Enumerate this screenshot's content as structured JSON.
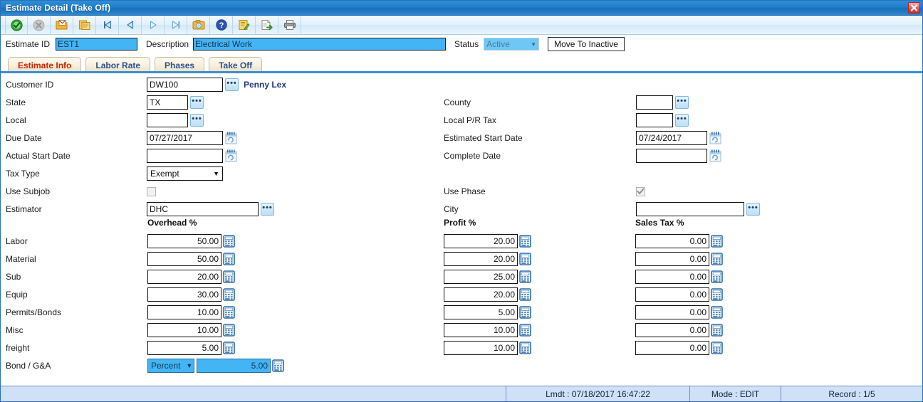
{
  "window": {
    "title": "Estimate Detail (Take Off)",
    "close_label": "×"
  },
  "toolbar": {
    "items": [
      {
        "name": "approve-icon",
        "tip": "Save"
      },
      {
        "name": "cancel-icon",
        "tip": "Delete"
      },
      {
        "name": "open-folder-icon",
        "tip": "Open"
      },
      {
        "name": "copy-icon",
        "tip": "Copy"
      },
      {
        "name": "first-record-icon",
        "tip": "First"
      },
      {
        "name": "previous-record-icon",
        "tip": "Previous"
      },
      {
        "name": "next-record-icon",
        "tip": "Next"
      },
      {
        "name": "last-record-icon",
        "tip": "Last"
      },
      {
        "name": "camera-icon",
        "tip": "Attachment"
      },
      {
        "name": "help-icon",
        "tip": "Help"
      },
      {
        "name": "edit-note-icon",
        "tip": "Notes"
      },
      {
        "name": "export-icon",
        "tip": "Export"
      },
      {
        "name": "print-icon",
        "tip": "Print"
      }
    ]
  },
  "header": {
    "estimate_id_label": "Estimate ID",
    "estimate_id_value": "EST1",
    "description_label": "Description",
    "description_value": "Electrical Work",
    "status_label": "Status",
    "status_value": "Active",
    "move_inactive_label": "Move To Inactive"
  },
  "tabs": [
    {
      "label": "Estimate Info",
      "active": true
    },
    {
      "label": "Labor Rate",
      "active": false
    },
    {
      "label": "Phases",
      "active": false
    },
    {
      "label": "Take Off",
      "active": false
    }
  ],
  "left_fields": {
    "customer_id_label": "Customer ID",
    "customer_id_value": "DW100",
    "customer_name": "Penny Lex",
    "state_label": "State",
    "state_value": "TX",
    "local_label": "Local",
    "local_value": "",
    "due_date_label": "Due Date",
    "due_date_value": "07/27/2017",
    "actual_start_label": "Actual Start Date",
    "actual_start_value": "",
    "tax_type_label": "Tax Type",
    "tax_type_value": "Exempt",
    "use_subjob_label": "Use Subjob",
    "estimator_label": "Estimator",
    "estimator_value": "DHC"
  },
  "right_fields": {
    "county_label": "County",
    "county_value": "",
    "local_pr_tax_label": "Local P/R Tax",
    "local_pr_tax_value": "",
    "estimated_start_label": "Estimated Start Date",
    "estimated_start_value": "07/24/2017",
    "complete_date_label": "Complete Date",
    "complete_date_value": "",
    "use_phase_label": "Use Phase",
    "city_label": "City",
    "city_value": ""
  },
  "percent_table": {
    "columns": [
      "Overhead %",
      "Profit %",
      "Sales Tax %"
    ],
    "rows": [
      {
        "label": "Labor",
        "overhead": "50.00",
        "profit": "20.00",
        "sales_tax": "0.00"
      },
      {
        "label": "Material",
        "overhead": "50.00",
        "profit": "20.00",
        "sales_tax": "0.00"
      },
      {
        "label": "Sub",
        "overhead": "20.00",
        "profit": "25.00",
        "sales_tax": "0.00"
      },
      {
        "label": "Equip",
        "overhead": "30.00",
        "profit": "20.00",
        "sales_tax": "0.00"
      },
      {
        "label": "Permits/Bonds",
        "overhead": "10.00",
        "profit": "5.00",
        "sales_tax": "0.00"
      },
      {
        "label": "Misc",
        "overhead": "10.00",
        "profit": "10.00",
        "sales_tax": "0.00"
      },
      {
        "label": "freight",
        "overhead": "5.00",
        "profit": "10.00",
        "sales_tax": "0.00"
      }
    ],
    "bond": {
      "label": "Bond / G&A",
      "mode": "Percent",
      "value": "5.00"
    }
  },
  "statusbar": {
    "lmdt": "Lmdt : 07/18/2017 16:47:22",
    "mode": "Mode : EDIT",
    "record": "Record : 1/5"
  },
  "colors": {
    "title_blue": "#1f7ec9",
    "field_blue": "#43b4f4",
    "tab_active_text": "#cc2200",
    "tab_text": "#2b4f8e",
    "status_bar": "#cfe0f7",
    "customer_name": "#23347a"
  }
}
